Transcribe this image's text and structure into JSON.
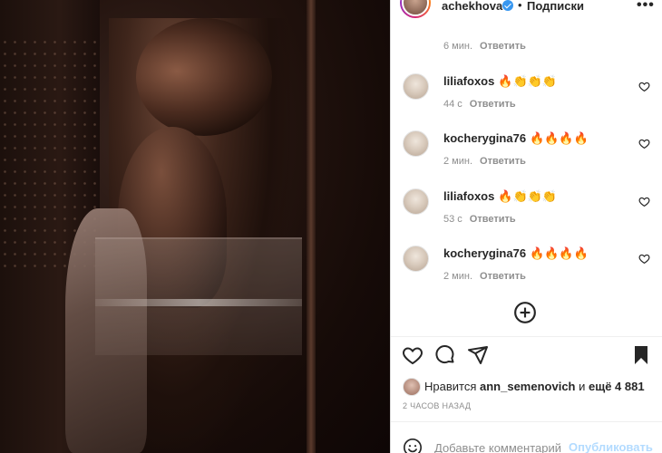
{
  "post": {
    "username": "achekhova",
    "verified": true,
    "follow_label": "Подписки",
    "separator": "•"
  },
  "top_meta": {
    "time": "6 мин.",
    "reply": "Ответить"
  },
  "comments": [
    {
      "user": "liliafoxos",
      "text": "🔥👏👏👏",
      "time": "44 с",
      "reply": "Ответить"
    },
    {
      "user": "kocherygina76",
      "text": "🔥🔥🔥🔥",
      "time": "2 мин.",
      "reply": "Ответить"
    },
    {
      "user": "liliafoxos",
      "text": "🔥👏👏👏",
      "time": "53 с",
      "reply": "Ответить"
    },
    {
      "user": "kocherygina76",
      "text": "🔥🔥🔥🔥",
      "time": "2 мин.",
      "reply": "Ответить"
    }
  ],
  "likes": {
    "prefix": "Нравится",
    "user": "ann_semenovich",
    "middle": "и",
    "count_text": "ещё 4 881"
  },
  "timestamp": "2 ЧАСОВ НАЗАД",
  "comment_box": {
    "placeholder": "Добавьте комментарий...",
    "publish_label": "Опубликовать"
  },
  "icons": {
    "header_more": "more-horizontal-icon",
    "verified": "verified-badge-icon",
    "like": "heart-icon",
    "comment": "comment-bubble-icon",
    "share": "paper-plane-icon",
    "save": "bookmark-icon",
    "load_more": "plus-circle-icon",
    "emoji": "smiley-icon"
  },
  "colors": {
    "verified": "#3897f0",
    "publish_disabled": "#b3dbff",
    "secondary_text": "#8e8e8e",
    "primary_text": "#262626"
  }
}
